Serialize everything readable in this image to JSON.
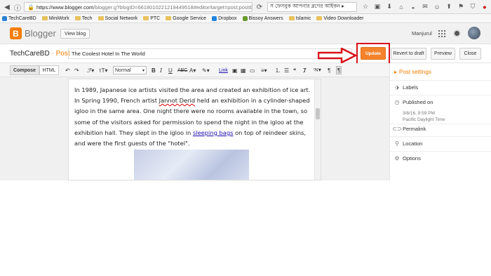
{
  "browser": {
    "url_host": "https://www.blogger.com",
    "url_path": "/blogger.g?blogID=6618010221219449518#editor/target=post;postID=26",
    "search_text": "স ফেসবুক আপনার ব্লগের আইকন ▸"
  },
  "bookmarks": [
    "TechCareBD",
    "MiniWork",
    "Tech",
    "Social Network",
    "PTC",
    "Google Service",
    "Dropbox",
    "Bissoy Answers",
    "Islamic",
    "Video Downloader"
  ],
  "header": {
    "logo_text": "Blogger",
    "view_blog": "View blog",
    "user_name": "Manjurul"
  },
  "titlebar": {
    "blog_name": "TechCareBD",
    "separator": "·",
    "post_type": "Post",
    "post_title": "The Coolest Hotel In The World",
    "update": "Update",
    "revert": "Revert to draft",
    "preview": "Preview",
    "close": "Close"
  },
  "toolbar": {
    "compose": "Compose",
    "html": "HTML",
    "font_size": "Normal",
    "link": "Link"
  },
  "content": {
    "text1": "In 1989, Japanese ice artists visited the area and created an exhibition of ice art. In Spring 1990, French artist ",
    "misspelled": "Jannot Derid",
    "text2": " held an exhibition in a cylinder-shaped igloo in the same area. One night there were no rooms available in the town, so some of the visitors asked for permission to spend the night in the igloo at the exhibition hall. They slept in the igloo in ",
    "link": "sleeping bags",
    "text3": " on top of reindeer skins, and were the first guests of the \"hotel\"."
  },
  "sidebar": {
    "title": "Post settings",
    "labels": "Labels",
    "published_on": "Published on",
    "published_date": "3/8/16, 9:59 PM",
    "timezone": "Pacific Daylight Time",
    "permalink": "Permalink",
    "location": "Location",
    "options": "Options"
  }
}
